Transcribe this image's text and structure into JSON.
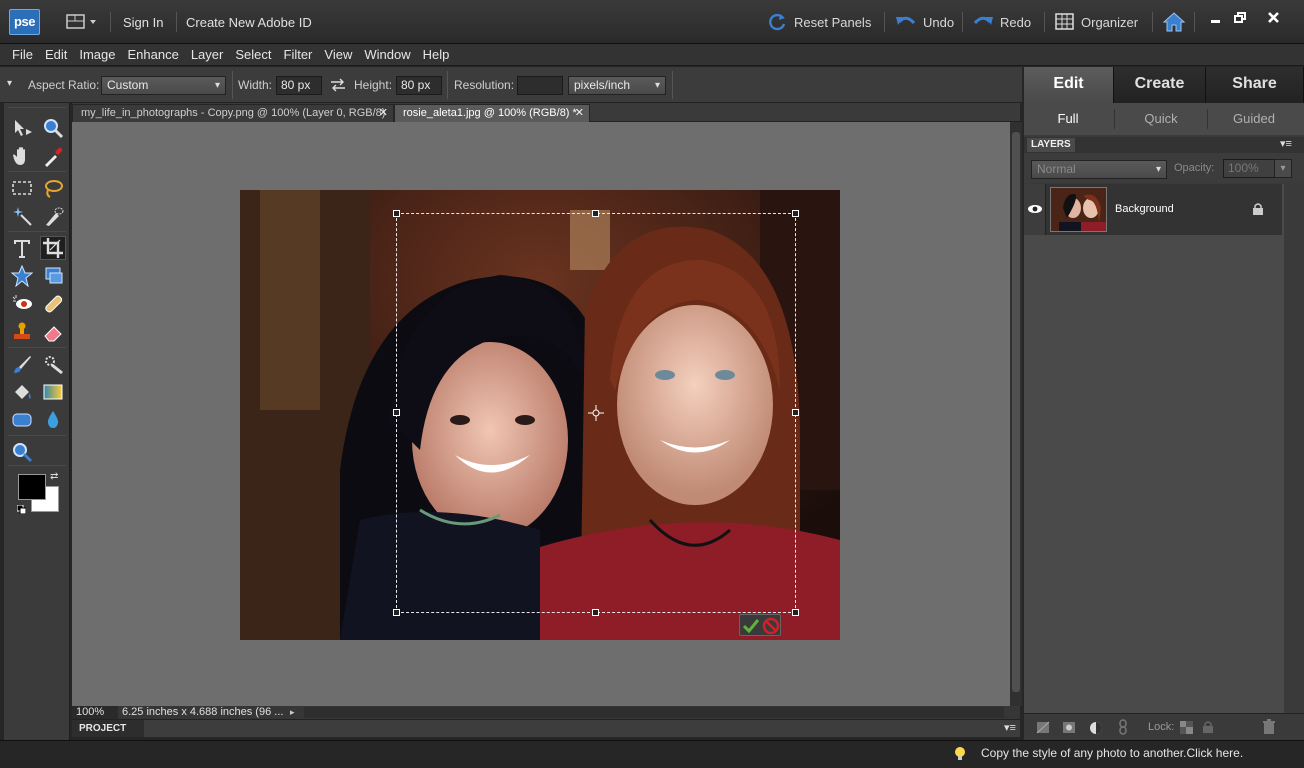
{
  "app": {
    "logo": "pse",
    "sign_in": "Sign In",
    "create_id": "Create New Adobe ID",
    "reset_panels": "Reset Panels",
    "undo": "Undo",
    "redo": "Redo",
    "organizer": "Organizer"
  },
  "menu": [
    "File",
    "Edit",
    "Image",
    "Enhance",
    "Layer",
    "Select",
    "Filter",
    "View",
    "Window",
    "Help"
  ],
  "options": {
    "aspect_label": "Aspect Ratio:",
    "aspect_value": "Custom",
    "width_label": "Width:",
    "width_value": "80 px",
    "height_label": "Height:",
    "height_value": "80 px",
    "resolution_label": "Resolution:",
    "resolution_value": "",
    "resolution_unit": "pixels/inch"
  },
  "doc_tabs": [
    {
      "label": "my_life_in_photographs - Copy.png @ 100% (Layer 0, RGB/8)",
      "active": false
    },
    {
      "label": "rosie_aleta1.jpg @ 100% (RGB/8) *",
      "active": true
    }
  ],
  "status": {
    "zoom": "100%",
    "doc_info": "6.25 inches x 4.688 inches (96 ...",
    "project_bin": "PROJECT BIN",
    "tip": "Copy the style of any photo to another.Click here."
  },
  "right_panel": {
    "tabs": [
      "Edit",
      "Create",
      "Share"
    ],
    "active_tab": "Edit",
    "modes": [
      "Full",
      "Quick",
      "Guided"
    ],
    "active_mode": "Full",
    "layers_title": "LAYERS",
    "blend_mode": "Normal",
    "opacity_label": "Opacity:",
    "opacity_value": "100%",
    "layer_name": "Background",
    "lock_label": "Lock:"
  },
  "colors": {
    "accent_blue": "#3b7fd0",
    "foreground": "#000000",
    "background": "#ffffff",
    "commit_green": "#5fb23a",
    "cancel_red": "#d0202a"
  }
}
